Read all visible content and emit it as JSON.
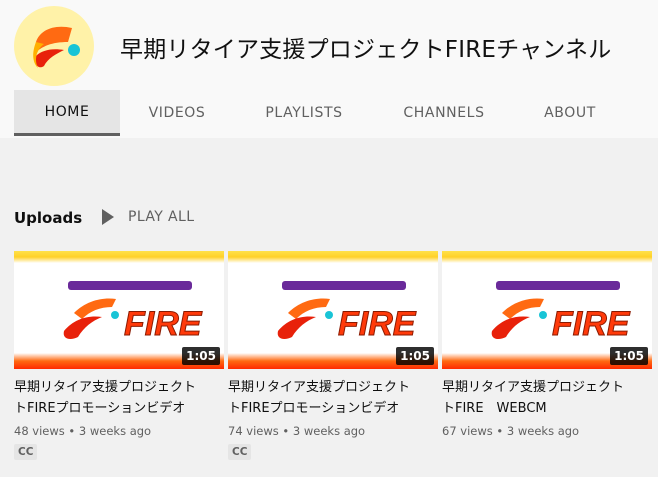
{
  "channel": {
    "name": "早期リタイア支援プロジェクトFIREチャンネル",
    "avatar_icon": "fire-logo-icon"
  },
  "tabs": [
    {
      "label": "HOME",
      "active": true
    },
    {
      "label": "VIDEOS"
    },
    {
      "label": "PLAYLISTS"
    },
    {
      "label": "CHANNELS"
    },
    {
      "label": "ABOUT"
    }
  ],
  "uploads": {
    "section_title": "Uploads",
    "play_all_label": "PLAY ALL",
    "play_icon": "play-icon"
  },
  "videos": [
    {
      "title_line1": "早期リタイア支援プロジェクト",
      "title_line2": "トFIREプロモーションビデオ",
      "duration": "1:05",
      "views": "48 views",
      "age": "3 weeks ago",
      "badge": "CC",
      "thumb_logo_text": "FIRE"
    },
    {
      "title_line1": "早期リタイア支援プロジェクト",
      "title_line2": "トFIREプロモーションビデオ",
      "duration": "1:05",
      "views": "74 views",
      "age": "3 weeks ago",
      "badge": "CC",
      "thumb_logo_text": "FIRE"
    },
    {
      "title_line1": "早期リタイア支援プロジェクト",
      "title_line2": "トFIRE　WEBCM",
      "duration": "1:05",
      "views": "67 views",
      "age": "3 weeks ago",
      "badge": "",
      "thumb_logo_text": "FIRE"
    }
  ],
  "colors": {
    "brand_orange": "#ff6a12",
    "brand_red": "#e8210a",
    "brand_yellow": "#ffd128",
    "teal_dot": "#19c4d6"
  }
}
